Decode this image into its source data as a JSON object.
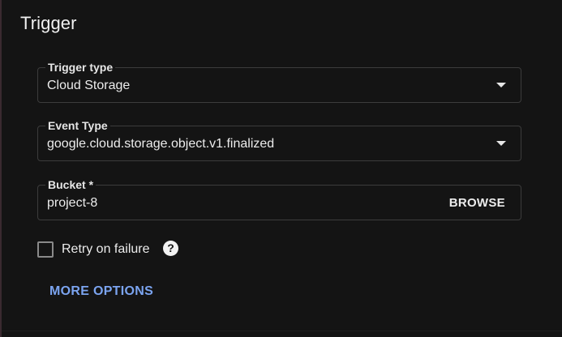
{
  "section": {
    "title": "Trigger"
  },
  "trigger_type": {
    "label": "Trigger type",
    "value": "Cloud Storage"
  },
  "event_type": {
    "label": "Event Type",
    "value": "google.cloud.storage.object.v1.finalized"
  },
  "bucket": {
    "label": "Bucket *",
    "value": "project-8",
    "browse_label": "BROWSE"
  },
  "retry": {
    "label": "Retry on failure",
    "checked": false,
    "help_glyph": "?"
  },
  "more_options": {
    "label": "MORE OPTIONS"
  },
  "colors": {
    "background": "#141414",
    "text": "#ececec",
    "link": "#7ba4f0",
    "border": "#3c3c3c"
  }
}
